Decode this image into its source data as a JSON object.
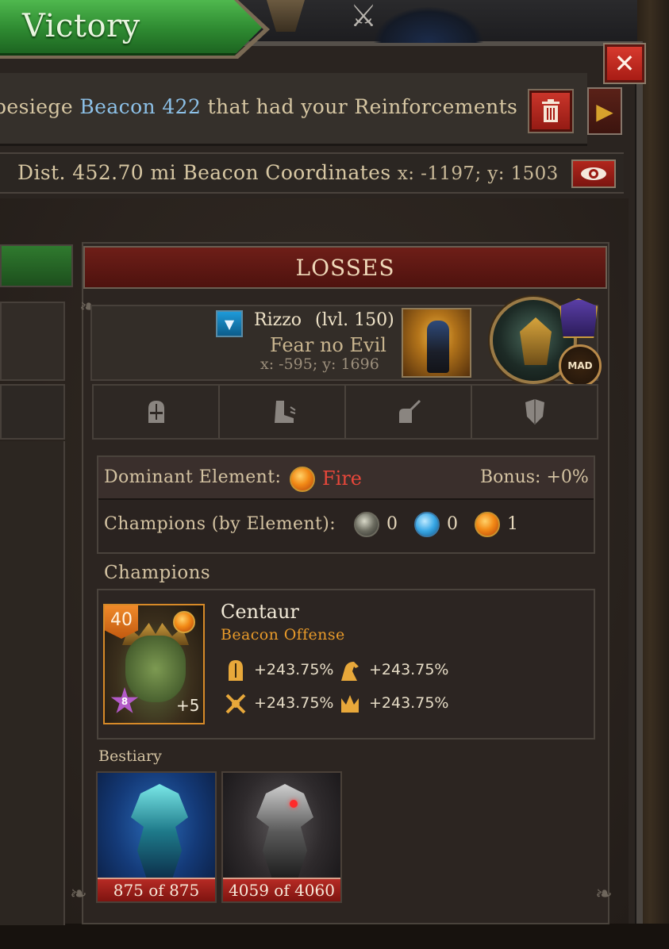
{
  "header": {
    "banner": "Victory",
    "close_label": "✕"
  },
  "message": {
    "part1": "besiege",
    "highlight": "Beacon 422",
    "part2": "that had your Reinforcements"
  },
  "location": {
    "dist_label": "Dist.",
    "dist_value": "452.70 mi",
    "coords_label": "Beacon Coordinates",
    "coords_value": "x: -1197; y: 1503"
  },
  "losses": {
    "title": "LOSSES",
    "player": {
      "name": "Rizzo",
      "level": "(lvl. 150)",
      "title": "Fear no Evil",
      "coords": "x: -595; y: 1696",
      "badge": "MAD"
    },
    "tabs": [
      {
        "icon": "helmet-icon"
      },
      {
        "icon": "boot-icon"
      },
      {
        "icon": "glove-icon"
      },
      {
        "icon": "shield-icon"
      }
    ],
    "elements": {
      "dominant_label": "Dominant Element:",
      "dominant_value": "Fire",
      "bonus": "Bonus: +0%",
      "champions_label": "Champions (by Element):",
      "counts": [
        {
          "element": "earth",
          "value": "0"
        },
        {
          "element": "water",
          "value": "0"
        },
        {
          "element": "fire",
          "value": "1"
        }
      ]
    },
    "champions_title": "Champions",
    "champion": {
      "level": "40",
      "rank": "8",
      "plus": "+5",
      "name": "Centaur",
      "role": "Beacon Offense",
      "stats": [
        {
          "icon": "helmet-icon",
          "value": "+243.75%"
        },
        {
          "icon": "horse-icon",
          "value": "+243.75%"
        },
        {
          "icon": "crossed-weapons-icon",
          "value": "+243.75%"
        },
        {
          "icon": "crown-icon",
          "value": "+243.75%"
        }
      ]
    },
    "bestiary_title": "Bestiary",
    "beasts": [
      {
        "hp": "875 of 875"
      },
      {
        "hp": "4059 of 4060"
      }
    ]
  },
  "colors": {
    "victory_green": "#2e8a31",
    "losses_red": "#6e1e18",
    "fire_text": "#e8473a",
    "role_orange": "#e89a2a",
    "highlight_blue": "#8dc1e8"
  }
}
